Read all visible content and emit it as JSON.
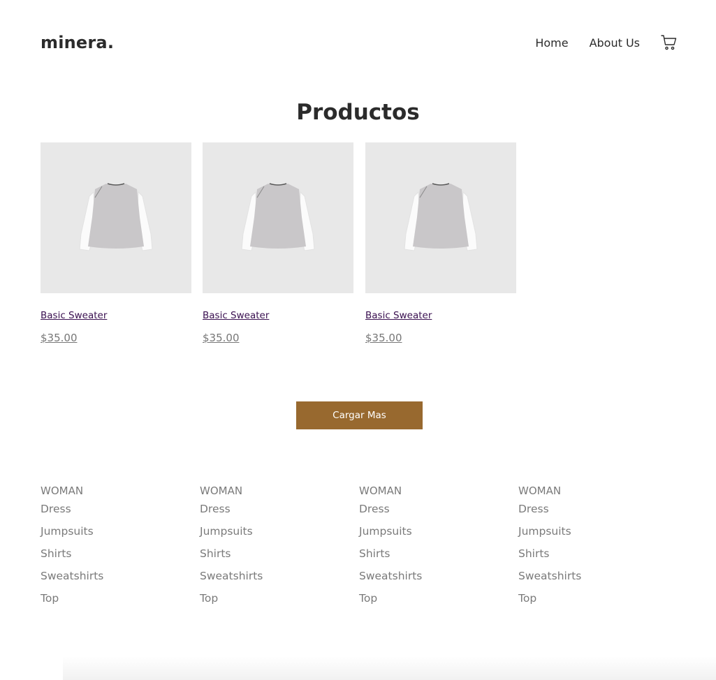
{
  "brand": {
    "logo": "minera."
  },
  "nav": {
    "items": [
      "Home",
      "About Us"
    ],
    "cart_icon": "cart-icon"
  },
  "page": {
    "title": "Productos"
  },
  "products": [
    {
      "name": "Basic Sweater",
      "price": "$35.00"
    },
    {
      "name": "Basic Sweater",
      "price": "$35.00"
    },
    {
      "name": "Basic Sweater",
      "price": "$35.00"
    }
  ],
  "actions": {
    "load_more": "Cargar Mas"
  },
  "footer": {
    "columns": [
      {
        "heading": "WOMAN",
        "links": [
          "Dress",
          "Jumpsuits",
          "Shirts",
          "Sweatshirts",
          "Top"
        ]
      },
      {
        "heading": "WOMAN",
        "links": [
          "Dress",
          "Jumpsuits",
          "Shirts",
          "Sweatshirts",
          "Top"
        ]
      },
      {
        "heading": "WOMAN",
        "links": [
          "Dress",
          "Jumpsuits",
          "Shirts",
          "Sweatshirts",
          "Top"
        ]
      },
      {
        "heading": "WOMAN",
        "links": [
          "Dress",
          "Jumpsuits",
          "Shirts",
          "Sweatshirts",
          "Top"
        ]
      }
    ]
  },
  "colors": {
    "accent": "#98692f",
    "product_bg": "#e8e8e8",
    "link": "#3a1050",
    "muted": "#7a7a7a"
  }
}
